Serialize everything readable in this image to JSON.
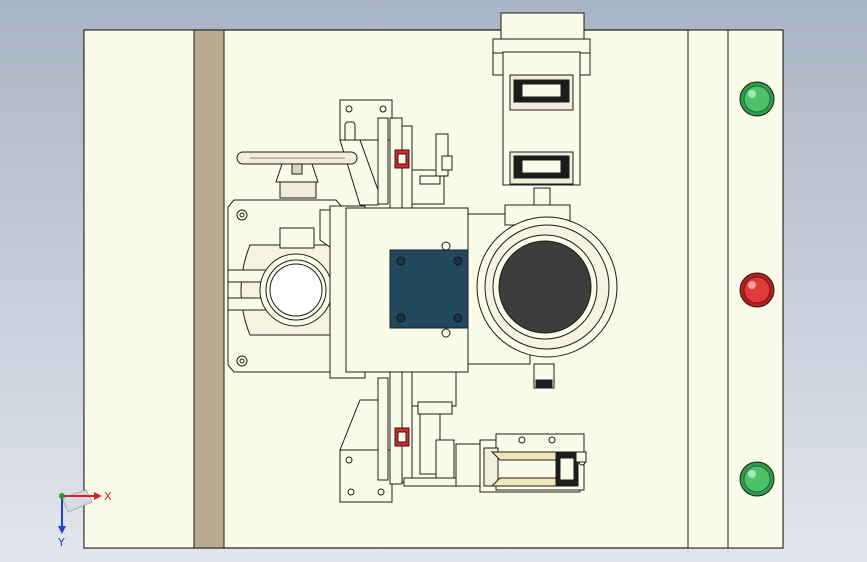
{
  "viewport": {
    "title": "",
    "triad": {
      "x_label": "X",
      "y_label": "Y"
    }
  },
  "colors": {
    "background_top": "#a9b4c4",
    "background_bottom": "#e2e6ec",
    "plate_fill": "#fbfbe9",
    "insulation_strip": "#b7ab8f",
    "outline": "#1c1c1c",
    "motor_plate": "#23495f",
    "indicator_green": "#3fae5a",
    "indicator_red": "#d12a2a",
    "lens_dark": "#3d3d3d",
    "sensor_red": "#e0262c",
    "axis_x": "#e02020",
    "axis_y": "#2a9a2a",
    "axis_z": "#2040d0"
  },
  "indicators": [
    {
      "name": "indicator-light-top",
      "color": "green"
    },
    {
      "name": "indicator-light-middle",
      "color": "red"
    },
    {
      "name": "indicator-light-bottom",
      "color": "green"
    }
  ]
}
